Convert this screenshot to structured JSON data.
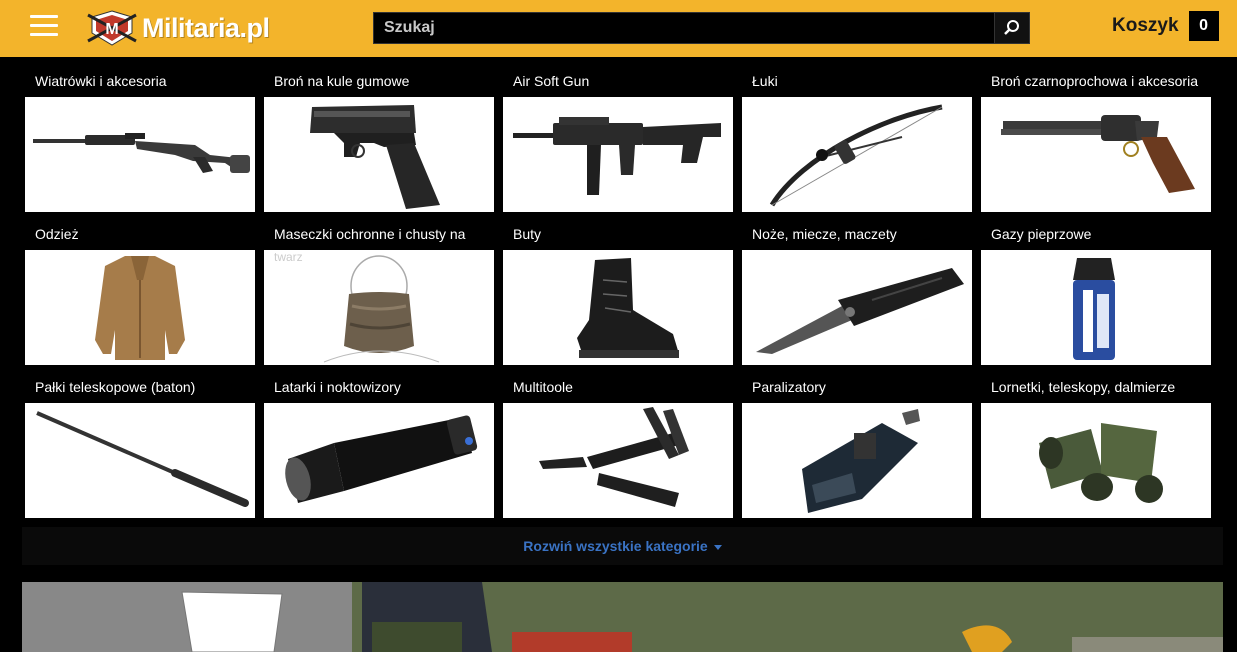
{
  "header": {
    "logo_text": "Militaria.pl",
    "logo_badge_letter": "M",
    "search_placeholder": "Szukaj",
    "cart_label": "Koszyk",
    "cart_count": "0"
  },
  "categories": [
    {
      "label": "Wiatrówki i akcesoria"
    },
    {
      "label": "Broń na kule gumowe"
    },
    {
      "label": "Air Soft Gun"
    },
    {
      "label": "Łuki"
    },
    {
      "label": "Broń czarnoprochowa i akcesoria"
    },
    {
      "label": "Odzież"
    },
    {
      "label": "Maseczki ochronne i chusty na"
    },
    {
      "label": "Buty"
    },
    {
      "label": "Noże, miecze, maczety"
    },
    {
      "label": "Gazy pieprzowe"
    },
    {
      "label": "Pałki teleskopowe (baton)"
    },
    {
      "label": "Latarki i noktowizory"
    },
    {
      "label": "Multitoole"
    },
    {
      "label": "Paralizatory"
    },
    {
      "label": "Lornetki, teleskopy, dalmierze"
    }
  ],
  "ghost_text": "twarz",
  "expand_label": "Rozwiń wszystkie kategorie",
  "colors": {
    "header_bg": "#f3b42b",
    "link": "#3a73c4"
  }
}
